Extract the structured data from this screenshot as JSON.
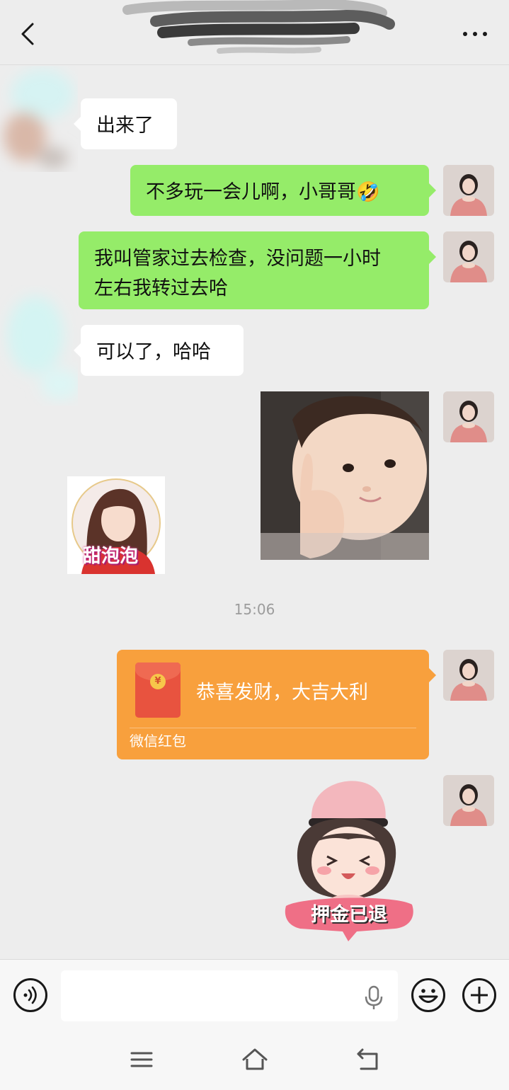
{
  "header": {
    "back_icon": "chevron-left-icon",
    "more_icon": "more-dots-icon"
  },
  "messages": [
    {
      "side": "in",
      "type": "text",
      "text": "出来了"
    },
    {
      "side": "out",
      "type": "text",
      "text": "不多玩一会儿啊，小哥哥🤣"
    },
    {
      "side": "out",
      "type": "text",
      "line1": "我叫管家过去检查，没问题一小时",
      "line2": "左右我转过去哈"
    },
    {
      "side": "in",
      "type": "text",
      "text": "可以了，哈哈"
    },
    {
      "side": "out",
      "type": "image",
      "description": "thumbs-up-child-sticker"
    },
    {
      "side": "in",
      "type": "image",
      "caption": "甜泡泡"
    }
  ],
  "timestamp": "15:06",
  "red_packet": {
    "title": "恭喜发财，大吉大利",
    "label": "微信红包",
    "coin": "¥"
  },
  "sticker": {
    "caption": "押金已退"
  },
  "input_bar": {
    "value": "",
    "placeholder": ""
  },
  "colors": {
    "background": "#ededed",
    "bubble_out": "#95ec69",
    "bubble_in": "#ffffff",
    "red_packet": "#f8a03d"
  }
}
